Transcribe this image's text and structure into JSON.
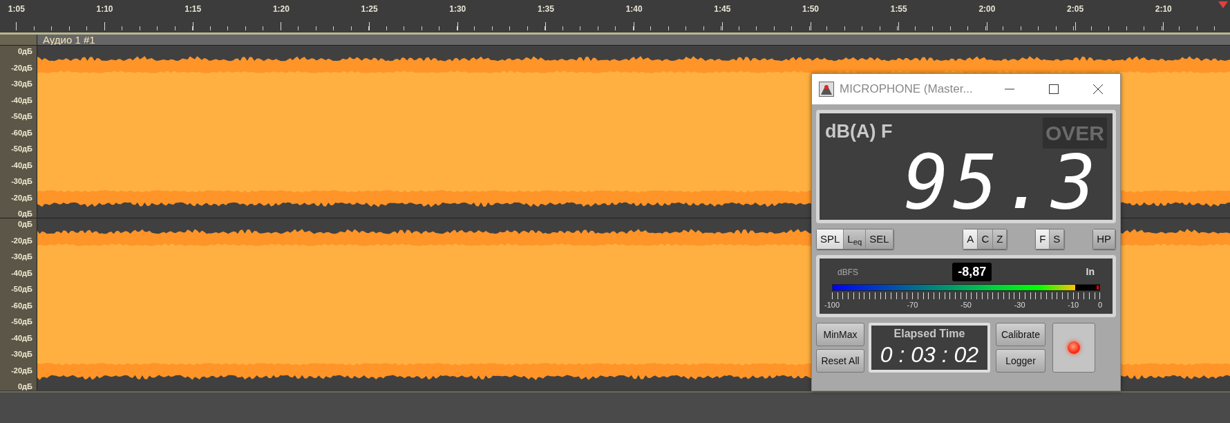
{
  "timeline": {
    "ticks": [
      "1:05",
      "1:10",
      "1:15",
      "1:20",
      "1:25",
      "1:30",
      "1:35",
      "1:40",
      "1:45",
      "1:50",
      "1:55",
      "2:00",
      "2:05",
      "2:10"
    ]
  },
  "track": {
    "title": "Аудио 1 #1",
    "channels": [
      {
        "scale": [
          "0дБ",
          "-20дБ",
          "-30дБ",
          "-40дБ",
          "-50дБ",
          "-60дБ",
          "-50дБ",
          "-40дБ",
          "-30дБ",
          "-20дБ",
          "0дБ"
        ]
      },
      {
        "scale": [
          "0дБ",
          "-20дБ",
          "-30дБ",
          "-40дБ",
          "-50дБ",
          "-60дБ",
          "-50дБ",
          "-40дБ",
          "-30дБ",
          "-20дБ",
          "0дБ"
        ]
      }
    ]
  },
  "meter": {
    "title": "MICROPHONE (Master...",
    "display": {
      "unit": "dB(A) F",
      "over_label": "OVER",
      "over": false,
      "reading": "95.3"
    },
    "groups": [
      {
        "buttons": [
          {
            "label": "SPL",
            "selected": true
          },
          {
            "label": "L$_{eq}$",
            "selected": false
          },
          {
            "label": "SEL",
            "selected": false
          }
        ]
      },
      {
        "buttons": [
          {
            "label": "A",
            "selected": true
          },
          {
            "label": "C",
            "selected": false
          },
          {
            "label": "Z",
            "selected": false
          }
        ]
      },
      {
        "buttons": [
          {
            "label": "F",
            "selected": true
          },
          {
            "label": "S",
            "selected": false
          }
        ]
      },
      {
        "buttons": [
          {
            "label": "HP",
            "selected": false
          }
        ]
      }
    ],
    "level_meter": {
      "unit": "dBFS",
      "value": "-8,87",
      "source": "In",
      "level": 0.91,
      "clip": true,
      "ticks": [
        "-100",
        "-70",
        "-50",
        "-30",
        "-10",
        "0"
      ]
    },
    "left_buttons": [
      "MinMax",
      "Reset All"
    ],
    "elapsed": {
      "title": "Elapsed Time",
      "value": "0 : 03 : 02"
    },
    "right_buttons": [
      "Calibrate",
      "Logger"
    ],
    "record_on": true
  }
}
